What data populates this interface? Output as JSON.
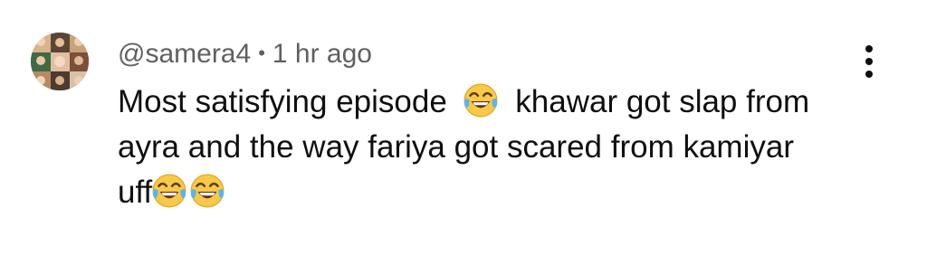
{
  "comment": {
    "author": "@samera4",
    "separator": "•",
    "timestamp": "1 hr ago",
    "text": {
      "line1_a": "Most satisfying episode",
      "line1_b": "khawar got slap from",
      "line2": "ayra and the way fariya got scared from kamiyar",
      "line3": "uff"
    },
    "emojis": [
      "face-with-tears-of-joy",
      "face-with-tears-of-joy",
      "face-with-tears-of-joy"
    ]
  },
  "icons": {
    "more": "more-vertical-icon",
    "avatar": "user-avatar"
  },
  "colors": {
    "text_primary": "#0f0f0f",
    "text_secondary": "#606060",
    "background": "#ffffff"
  }
}
